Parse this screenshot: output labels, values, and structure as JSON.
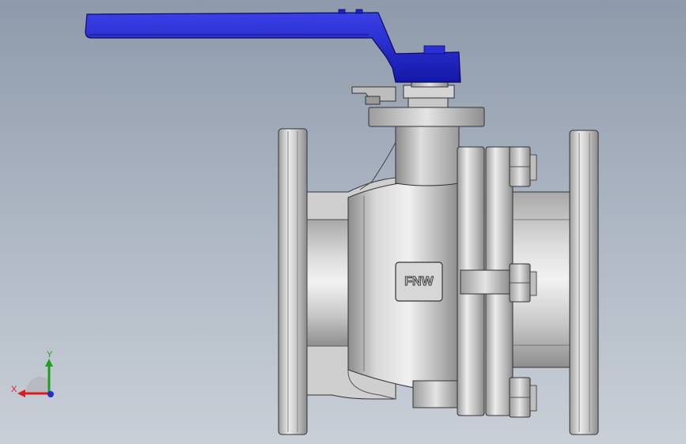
{
  "viewport": {
    "background_top": "#8e9aab",
    "background_bottom": "#c9cfd7"
  },
  "model": {
    "part": "ball-valve",
    "body_marking": "FNW",
    "handle_color": "#1d22c8",
    "body_color": "#c4c4c4"
  },
  "triad": {
    "x_label": "X",
    "y_label": "Y",
    "x_color": "#d81e1e",
    "y_color": "#1ea01e",
    "z_color": "#2030c8"
  }
}
